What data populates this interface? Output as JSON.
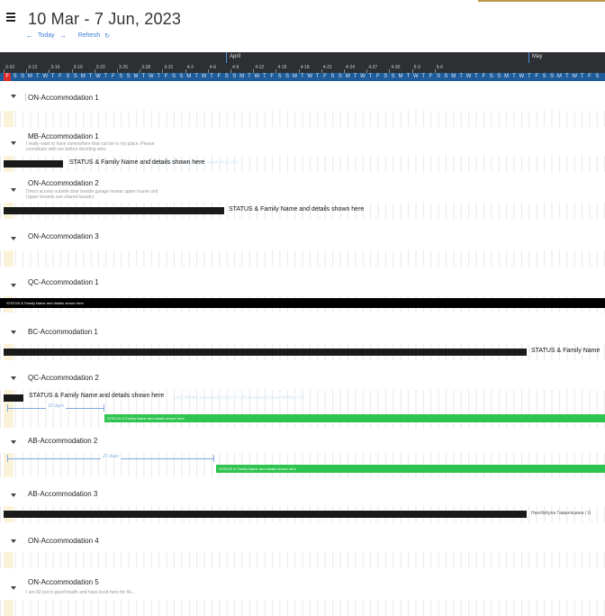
{
  "header": {
    "title": "10 Mar - 7 Jun, 2023",
    "today": "Today",
    "refresh": "Refresh"
  },
  "timeline": {
    "months": [
      "April",
      "May"
    ],
    "dates": [
      "3-10",
      "3-13",
      "3-16",
      "3-19",
      "3-22",
      "3-25",
      "3-28",
      "3-31",
      "4-3",
      "4-6",
      "4-9",
      "4-12",
      "4-15",
      "4-18",
      "4-21",
      "4-24",
      "4-27",
      "4-30",
      "5-3",
      "5-6"
    ],
    "days": [
      "F",
      "S",
      "S",
      "M",
      "T",
      "W",
      "T",
      "F",
      "S",
      "S",
      "M",
      "T",
      "W",
      "T",
      "F",
      "S",
      "S",
      "M",
      "T",
      "W",
      "T",
      "F",
      "S",
      "S",
      "M",
      "T",
      "W",
      "T",
      "F",
      "S",
      "S",
      "M",
      "T",
      "W",
      "T",
      "F",
      "S",
      "S",
      "M",
      "T",
      "W",
      "T",
      "F",
      "S",
      "S",
      "M",
      "T",
      "W",
      "T",
      "F",
      "S",
      "S",
      "M",
      "T",
      "W",
      "T",
      "F",
      "S",
      "S",
      "M",
      "T",
      "W",
      "T",
      "F",
      "S",
      "S",
      "M",
      "T",
      "W",
      "T",
      "F",
      "S",
      "S",
      "M",
      "T",
      "W",
      "T",
      "F",
      "S"
    ]
  },
  "sections": [
    {
      "name": "ON-Accommodation 1"
    },
    {
      "name": "MB-Accommodation 1",
      "note": "I really want to have somewhere that can be in my place. Please coordinate with me before deciding who.",
      "bar_label": "STATUS & Family Name and details shown here",
      "ghost": "...| 2 Fisherville 5 Fisherville Rd, North York, ON"
    },
    {
      "name": "ON-Accommodation 2",
      "note": "Direct access outside door beside garage lowest upper house unit Upper tenants use shared laundry",
      "bar_label": "STATUS & Family Name and details shown here",
      "ghost": "...n"
    },
    {
      "name": "ON-Accommodation 3"
    },
    {
      "name": "QC-Accommodation 1",
      "bar_label": "STATUS & Family Name and details shown here"
    },
    {
      "name": "BC-Accommodation 1",
      "bar_label": "STATUS & Family Name"
    },
    {
      "name": "QC-Accommodation 2",
      "bar_label": "STATUS & Family Name and details shown here",
      "ghost": "...pol | Whitby Greenfield Unit 2-1-108 Greenfield Cres, Whitby, ON",
      "span_label": "10 days",
      "green_label": "STATUS & Family Name and details shown here"
    },
    {
      "name": "AB-Accommodation 2",
      "span_label": "21 days",
      "green_label": "STATUS & Family Name and details shown here"
    },
    {
      "name": "AB-Accommodation 3",
      "bar_label": "Havrilishyna Гаврилішина | G"
    },
    {
      "name": "ON-Accommodation 4"
    },
    {
      "name": "ON-Accommodation 5",
      "note": "I am 82 but in good health and have lived here for 56..."
    }
  ]
}
